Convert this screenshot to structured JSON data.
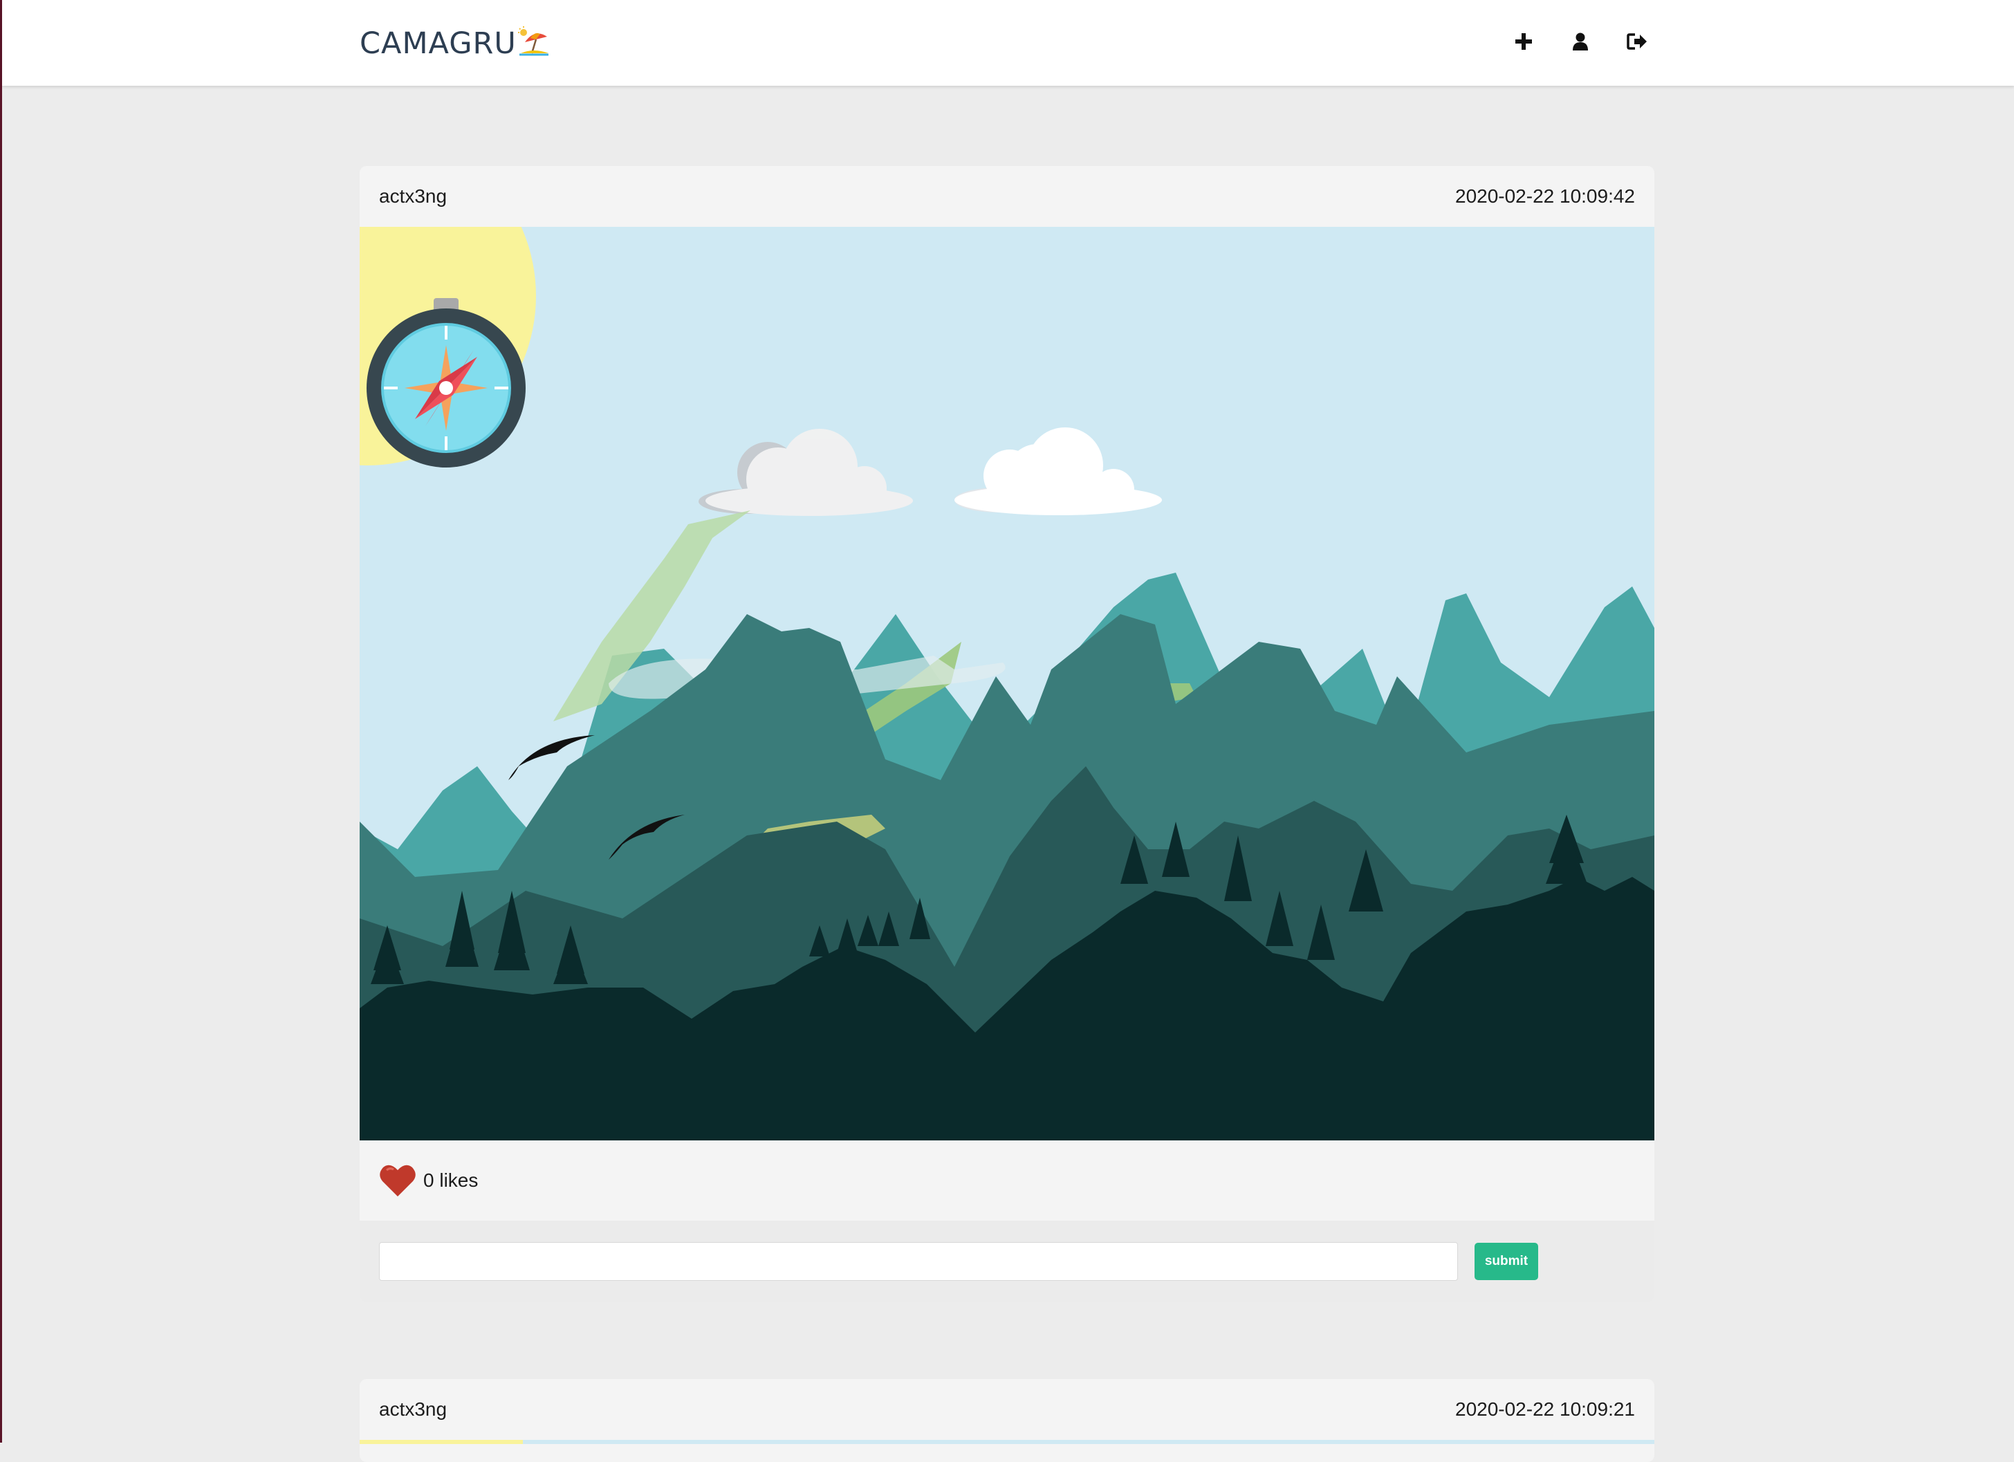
{
  "app": {
    "logo_text": "CAMAGRU"
  },
  "nav": {
    "icons": [
      "plus-icon",
      "user-icon",
      "sign-out-icon"
    ]
  },
  "posts": [
    {
      "author": "actx3ng",
      "timestamp": "2020-02-22 10:09:42",
      "likes_label": "0 likes",
      "comment_placeholder": "",
      "submit_label": "submit"
    },
    {
      "author": "actx3ng",
      "timestamp": "2020-02-22 10:09:21"
    }
  ],
  "colors": {
    "accent": "#27b98a",
    "heart": "#c0392b",
    "logo": "#2d3e52",
    "sky": "#cfe9f3",
    "sun": "#f9f39a"
  }
}
